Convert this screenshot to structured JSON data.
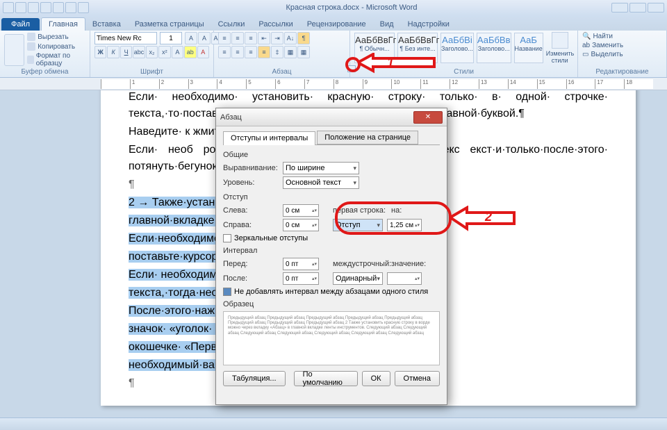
{
  "titlebar": {
    "title": "Красная строка.docx - Microsoft Word"
  },
  "tabs": {
    "file": "Файл",
    "items": [
      "Главная",
      "Вставка",
      "Разметка страницы",
      "Ссылки",
      "Рассылки",
      "Рецензирование",
      "Вид",
      "Надстройки"
    ],
    "active_index": 0
  },
  "ribbon": {
    "clipboard": {
      "label": "Буфер обмена",
      "paste": "Вставить",
      "cut": "Вырезать",
      "copy": "Копировать",
      "format": "Формат по образцу"
    },
    "font": {
      "label": "Шрифт",
      "family": "Times New Rc",
      "size": "1"
    },
    "paragraph": {
      "label": "Абзац"
    },
    "styles": {
      "label": "Стили",
      "items": [
        {
          "preview": "АаБбВвГг",
          "name": "¶ Обычн..."
        },
        {
          "preview": "АаБбВвГг",
          "name": "¶ Без инте..."
        },
        {
          "preview": "АаБбВі",
          "name": "Заголово..."
        },
        {
          "preview": "АаБбВв",
          "name": "Заголово..."
        },
        {
          "preview": "АаБ",
          "name": "Название"
        }
      ],
      "change": "Изменить стили"
    },
    "editing": {
      "label": "Редактирование",
      "find": "Найти",
      "replace": "Заменить",
      "select": "Выделить"
    }
  },
  "ruler": {
    "ticks": [
      " ",
      "1",
      "2",
      "3",
      "4",
      "5",
      "6",
      "7",
      "8",
      "9",
      "10",
      "11",
      "12",
      "13",
      "14",
      "15",
      "16",
      "17",
      "18"
    ]
  },
  "doc": {
    "p1": "Если· необходимо· установить· красную· строку· только· в· одной· строчке· текста,·то·поставьте·курсор·в·начале·этой·строки·перед·заглавной·буквой.¶",
    "p2": "Наведите· к                                                                                 жмите·на·левую·клавишу· мышки·и·потянит                                                                            е.¶",
    "p3": "Если· необ                                                                                  року· во· всех· абзацах· напечатанного·текс                                                                                екст·и·только·после·этого· потянуть·бегунок                                                                                 ",
    "pil": "¶",
    "sel1": "2   →   Также·устан                                                                            ерез·вкладку·«Абзац»·в·",
    "sel2": "главной·вкладке·л                                                                             ",
    "sel3": "Если·необходимо                                                                            одной·строчке·текста,·то·",
    "sel4": "поставьте·курсор·                                                                            уквой.¶",
    "sel5": "Если· необходимо                                                                            х· абзацах· напечатанного·",
    "sel6": "текста,·тогда·необ                                                                            ",
    "sel7": "После·этого·нажм                                                                            ова·«Абзац»·нажмите·на·",
    "sel8": "значок· «уголок· в                                                                            шемся· окне· в· активном·",
    "sel9": "окошечке· «Перв                                                                            справа· от· него· задайте·",
    "sel10": "необходимый·вам                                                                            ",
    "pil2": "¶"
  },
  "dialog": {
    "title": "Абзац",
    "tabs": [
      "Отступы и интервалы",
      "Положение на странице"
    ],
    "section_general": "Общие",
    "align_label": "Выравнивание:",
    "align_value": "По ширине",
    "level_label": "Уровень:",
    "level_value": "Основной текст",
    "section_indent": "Отступ",
    "left_label": "Слева:",
    "left_value": "0 см",
    "right_label": "Справа:",
    "right_value": "0 см",
    "first_label": "первая строка:",
    "by_label": "на:",
    "first_value": "Отступ",
    "by_value": "1,25 см",
    "mirror": "Зеркальные отступы",
    "section_spacing": "Интервал",
    "before_label": "Перед:",
    "before_value": "0 пт",
    "after_label": "После:",
    "after_value": "0 пт",
    "line_label": "междустрочный:",
    "line_at_label": "значение:",
    "line_value": "Одинарный",
    "line_at_value": "",
    "nospace": "Не добавлять интервал между абзацами одного стиля",
    "sample_label": "Образец",
    "preview": "Предыдущий абзац Предыдущий абзац Предыдущий абзац Предыдущий абзац Предыдущий абзац Предыдущий абзац Предыдущий абзац Предыдущий абзац\n    2    Также установить красную строку в ворде можно через вкладку «Абзац» в главной вкладке ленты инструментов.\nСледующий абзац Следующий абзац Следующий абзац Следующий абзац Следующий абзац Следующий абзац Следующий абзац",
    "tabstops": "Табуляция...",
    "default": "По умолчанию",
    "ok": "ОК",
    "cancel": "Отмена"
  },
  "annotations": {
    "label1": "1",
    "label2": "2"
  }
}
